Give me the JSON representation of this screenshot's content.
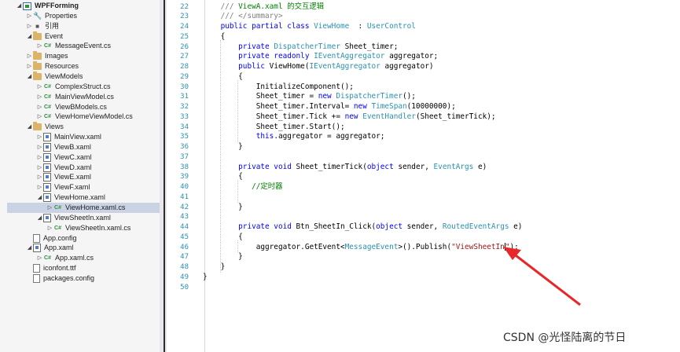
{
  "explorer": {
    "items": [
      {
        "label": "WPFForming",
        "icon": "project-icon",
        "arrow": "expanded",
        "indent": 0,
        "bold": true
      },
      {
        "label": "Properties",
        "icon": "wrench-icon",
        "arrow": "collapsed",
        "indent": 1
      },
      {
        "label": "引用",
        "icon": "references-icon",
        "arrow": "collapsed",
        "indent": 1
      },
      {
        "label": "Event",
        "icon": "folder-icon",
        "arrow": "expanded",
        "indent": 1
      },
      {
        "label": "MessageEvent.cs",
        "icon": "csharp-file-icon",
        "arrow": "collapsed",
        "indent": 2
      },
      {
        "label": "Images",
        "icon": "folder-icon",
        "arrow": "collapsed",
        "indent": 1
      },
      {
        "label": "Resources",
        "icon": "folder-icon",
        "arrow": "collapsed",
        "indent": 1
      },
      {
        "label": "ViewModels",
        "icon": "folder-icon",
        "arrow": "expanded",
        "indent": 1
      },
      {
        "label": "ComplexStruct.cs",
        "icon": "csharp-file-icon",
        "arrow": "collapsed",
        "indent": 2
      },
      {
        "label": "MainViewModel.cs",
        "icon": "csharp-file-icon",
        "arrow": "collapsed",
        "indent": 2
      },
      {
        "label": "ViewBModels.cs",
        "icon": "csharp-file-icon",
        "arrow": "collapsed",
        "indent": 2
      },
      {
        "label": "ViewHomeViewModel.cs",
        "icon": "csharp-file-icon",
        "arrow": "collapsed",
        "indent": 2
      },
      {
        "label": "Views",
        "icon": "folder-icon",
        "arrow": "expanded",
        "indent": 1
      },
      {
        "label": "MainView.xaml",
        "icon": "xaml-file-icon",
        "arrow": "collapsed",
        "indent": 2
      },
      {
        "label": "ViewB.xaml",
        "icon": "xaml-file-icon",
        "arrow": "collapsed",
        "indent": 2
      },
      {
        "label": "ViewC.xaml",
        "icon": "xaml-file-icon",
        "arrow": "collapsed",
        "indent": 2
      },
      {
        "label": "ViewD.xaml",
        "icon": "xaml-file-icon",
        "arrow": "collapsed",
        "indent": 2
      },
      {
        "label": "ViewE.xaml",
        "icon": "xaml-file-icon",
        "arrow": "collapsed",
        "indent": 2
      },
      {
        "label": "ViewF.xaml",
        "icon": "xaml-file-icon",
        "arrow": "collapsed",
        "indent": 2
      },
      {
        "label": "ViewHome.xaml",
        "icon": "xaml-file-icon",
        "arrow": "expanded",
        "indent": 2
      },
      {
        "label": "ViewHome.xaml.cs",
        "icon": "csharp-file-icon",
        "arrow": "collapsed",
        "indent": 3,
        "selected": true
      },
      {
        "label": "ViewSheetIn.xaml",
        "icon": "xaml-file-icon",
        "arrow": "expanded",
        "indent": 2
      },
      {
        "label": "ViewSheetIn.xaml.cs",
        "icon": "csharp-file-icon",
        "arrow": "collapsed",
        "indent": 3
      },
      {
        "label": "App.config",
        "icon": "config-file-icon",
        "arrow": "none",
        "indent": 1
      },
      {
        "label": "App.xaml",
        "icon": "xaml-file-icon",
        "arrow": "expanded",
        "indent": 1
      },
      {
        "label": "App.xaml.cs",
        "icon": "csharp-file-icon",
        "arrow": "collapsed",
        "indent": 2
      },
      {
        "label": "iconfont.ttf",
        "icon": "font-file-icon",
        "arrow": "none",
        "indent": 1
      },
      {
        "label": "packages.config",
        "icon": "config-file-icon",
        "arrow": "none",
        "indent": 1
      }
    ]
  },
  "editor": {
    "lines": [
      {
        "n": "22",
        "tokens": [
          [
            "cmg",
            "    /// "
          ],
          [
            "cm",
            "ViewA.xaml 的交互逻辑"
          ]
        ]
      },
      {
        "n": "23",
        "tokens": [
          [
            "cmg",
            "    /// </summary>"
          ]
        ]
      },
      {
        "n": "24",
        "tokens": [
          [
            "kw",
            "    public partial class "
          ],
          [
            "ty",
            "ViewHome"
          ],
          [
            "",
            "  : "
          ],
          [
            "ty",
            "UserControl"
          ]
        ]
      },
      {
        "n": "25",
        "tokens": [
          [
            "",
            "    {"
          ]
        ]
      },
      {
        "n": "26",
        "tokens": [
          [
            "kw",
            "        private "
          ],
          [
            "ty",
            "DispatcherTimer"
          ],
          [
            "",
            " Sheet_timer;"
          ]
        ]
      },
      {
        "n": "27",
        "tokens": [
          [
            "kw",
            "        private readonly "
          ],
          [
            "ty",
            "IEventAggregator"
          ],
          [
            "",
            " aggregator;"
          ]
        ]
      },
      {
        "n": "28",
        "tokens": [
          [
            "kw",
            "        public "
          ],
          [
            "",
            "ViewHome("
          ],
          [
            "ty",
            "IEventAggregator"
          ],
          [
            "",
            " aggregator)"
          ]
        ]
      },
      {
        "n": "29",
        "tokens": [
          [
            "",
            "        {"
          ]
        ]
      },
      {
        "n": "30",
        "tokens": [
          [
            "",
            "            InitializeComponent();"
          ]
        ]
      },
      {
        "n": "31",
        "tokens": [
          [
            "",
            "            Sheet_timer = "
          ],
          [
            "kw",
            "new "
          ],
          [
            "ty",
            "DispatcherTimer"
          ],
          [
            "",
            "();"
          ]
        ]
      },
      {
        "n": "32",
        "tokens": [
          [
            "",
            "            Sheet_timer.Interval= "
          ],
          [
            "kw",
            "new "
          ],
          [
            "ty",
            "TimeSpan"
          ],
          [
            "",
            "(10000000);"
          ]
        ]
      },
      {
        "n": "33",
        "tokens": [
          [
            "",
            "            Sheet_timer.Tick += "
          ],
          [
            "kw",
            "new "
          ],
          [
            "ty",
            "EventHandler"
          ],
          [
            "",
            "(Sheet_timerTick);"
          ]
        ]
      },
      {
        "n": "34",
        "tokens": [
          [
            "",
            "            Sheet_timer.Start();"
          ]
        ]
      },
      {
        "n": "35",
        "tokens": [
          [
            "kw",
            "            this"
          ],
          [
            "",
            ".aggregator = aggregator;"
          ]
        ]
      },
      {
        "n": "36",
        "tokens": [
          [
            "",
            "        }"
          ]
        ]
      },
      {
        "n": "37",
        "tokens": [
          [
            "",
            ""
          ]
        ]
      },
      {
        "n": "38",
        "tokens": [
          [
            "kw",
            "        private void "
          ],
          [
            "",
            "Sheet_timerTick("
          ],
          [
            "kw",
            "object"
          ],
          [
            "",
            " sender, "
          ],
          [
            "ty",
            "EventArgs"
          ],
          [
            "",
            " e)"
          ]
        ]
      },
      {
        "n": "39",
        "tokens": [
          [
            "",
            "        {"
          ]
        ]
      },
      {
        "n": "40",
        "tokens": [
          [
            "cm",
            "           //定时器"
          ]
        ]
      },
      {
        "n": "41",
        "tokens": [
          [
            "",
            ""
          ]
        ]
      },
      {
        "n": "42",
        "tokens": [
          [
            "",
            "        }"
          ]
        ]
      },
      {
        "n": "43",
        "tokens": [
          [
            "",
            ""
          ]
        ]
      },
      {
        "n": "44",
        "tokens": [
          [
            "kw",
            "        private void "
          ],
          [
            "",
            "Btn_SheetIn_Click("
          ],
          [
            "kw",
            "object"
          ],
          [
            "",
            " sender, "
          ],
          [
            "ty",
            "RoutedEventArgs"
          ],
          [
            "",
            " e)"
          ]
        ]
      },
      {
        "n": "45",
        "tokens": [
          [
            "",
            "        {"
          ]
        ]
      },
      {
        "n": "46",
        "tokens": [
          [
            "",
            "            aggregator.GetEvent<"
          ],
          [
            "ty",
            "MessageEvent"
          ],
          [
            "",
            ">().Publish("
          ],
          [
            "st",
            "\"ViewSheetIn"
          ],
          [
            "caret",
            ""
          ],
          [
            "st",
            "\""
          ],
          [
            "",
            ");"
          ]
        ]
      },
      {
        "n": "47",
        "tokens": [
          [
            "",
            "        }"
          ]
        ]
      },
      {
        "n": "48",
        "tokens": [
          [
            "",
            "    }"
          ]
        ]
      },
      {
        "n": "49",
        "tokens": [
          [
            "",
            "}"
          ]
        ]
      },
      {
        "n": "50",
        "tokens": [
          [
            "",
            ""
          ]
        ]
      }
    ]
  },
  "watermark": "CSDN @光怪陆离的节日",
  "colors": {
    "keyword": "#0000ff",
    "type": "#2b91af",
    "comment": "#008000",
    "string": "#a31515",
    "arrow": "#e8272a"
  }
}
